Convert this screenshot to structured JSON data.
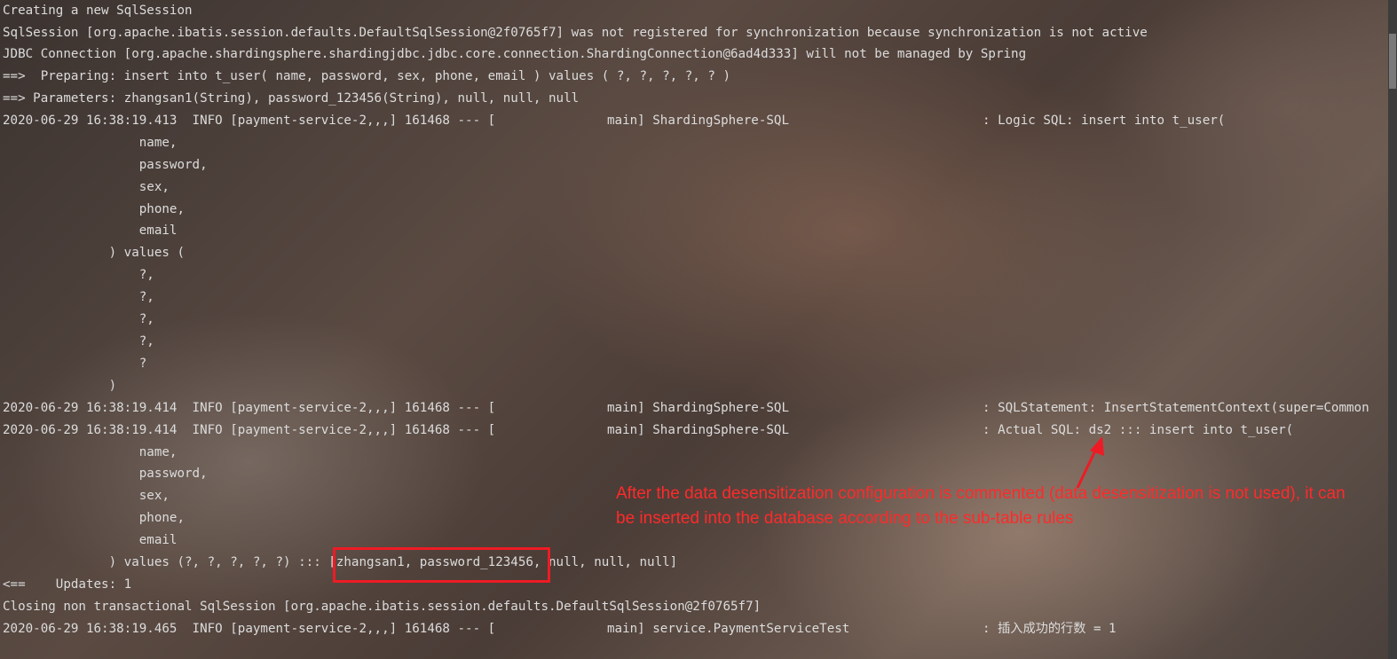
{
  "console": {
    "lines": [
      "Creating a new SqlSession",
      "SqlSession [org.apache.ibatis.session.defaults.DefaultSqlSession@2f0765f7] was not registered for synchronization because synchronization is not active",
      "JDBC Connection [org.apache.shardingsphere.shardingjdbc.jdbc.core.connection.ShardingConnection@6ad4d333] will not be managed by Spring",
      "==>  Preparing: insert into t_user( name, password, sex, phone, email ) values ( ?, ?, ?, ?, ? )",
      "==> Parameters: zhangsan1(String), password_123456(String), null, null, null",
      "2020-06-29 16:38:19.413  INFO [payment-service-2,,,] 161468 --- [",
      "                  name,",
      "                  password,",
      "                  sex,",
      "                  phone,",
      "                  email",
      "              ) values (",
      "                  ?,",
      "                  ?,",
      "                  ?,",
      "                  ?,",
      "                  ?",
      "              )",
      "2020-06-29 16:38:19.414  INFO [payment-service-2,,,] 161468 --- [",
      "2020-06-29 16:38:19.414  INFO [payment-service-2,,,] 161468 --- [",
      "                  name,",
      "                  password,",
      "                  sex,",
      "                  phone,",
      "                  email",
      "              ) values (?, ?, ?, ?, ?) ::: [zhangsan1, password_123456, null, null, null]",
      "<==    Updates: 1",
      "Closing non transactional SqlSession [org.apache.ibatis.session.defaults.DefaultSqlSession@2f0765f7]",
      "2020-06-29 16:38:19.465  INFO [payment-service-2,,,] 161468 --- ["
    ],
    "log_entries": [
      {
        "thread": "main] ShardingSphere-SQL",
        "message": ": Logic SQL: insert into t_user("
      },
      {
        "thread": "main] ShardingSphere-SQL",
        "message": ": SQLStatement: InsertStatementContext(super=Common"
      },
      {
        "thread": "main] ShardingSphere-SQL",
        "message": ": Actual SQL: ds2 ::: insert into t_user("
      },
      {
        "thread": "main] service.PaymentServiceTest",
        "message": ": 插入成功的行数 = 1"
      }
    ]
  },
  "annotation": {
    "text": "After the data desensitization configuration is commented (data desensitization is not used), it can be inserted into the database according to the sub-table rules",
    "color": "#ff2a2a"
  },
  "colors": {
    "console_text": "#dcdcdc",
    "highlight_box": "#ee1b24"
  }
}
